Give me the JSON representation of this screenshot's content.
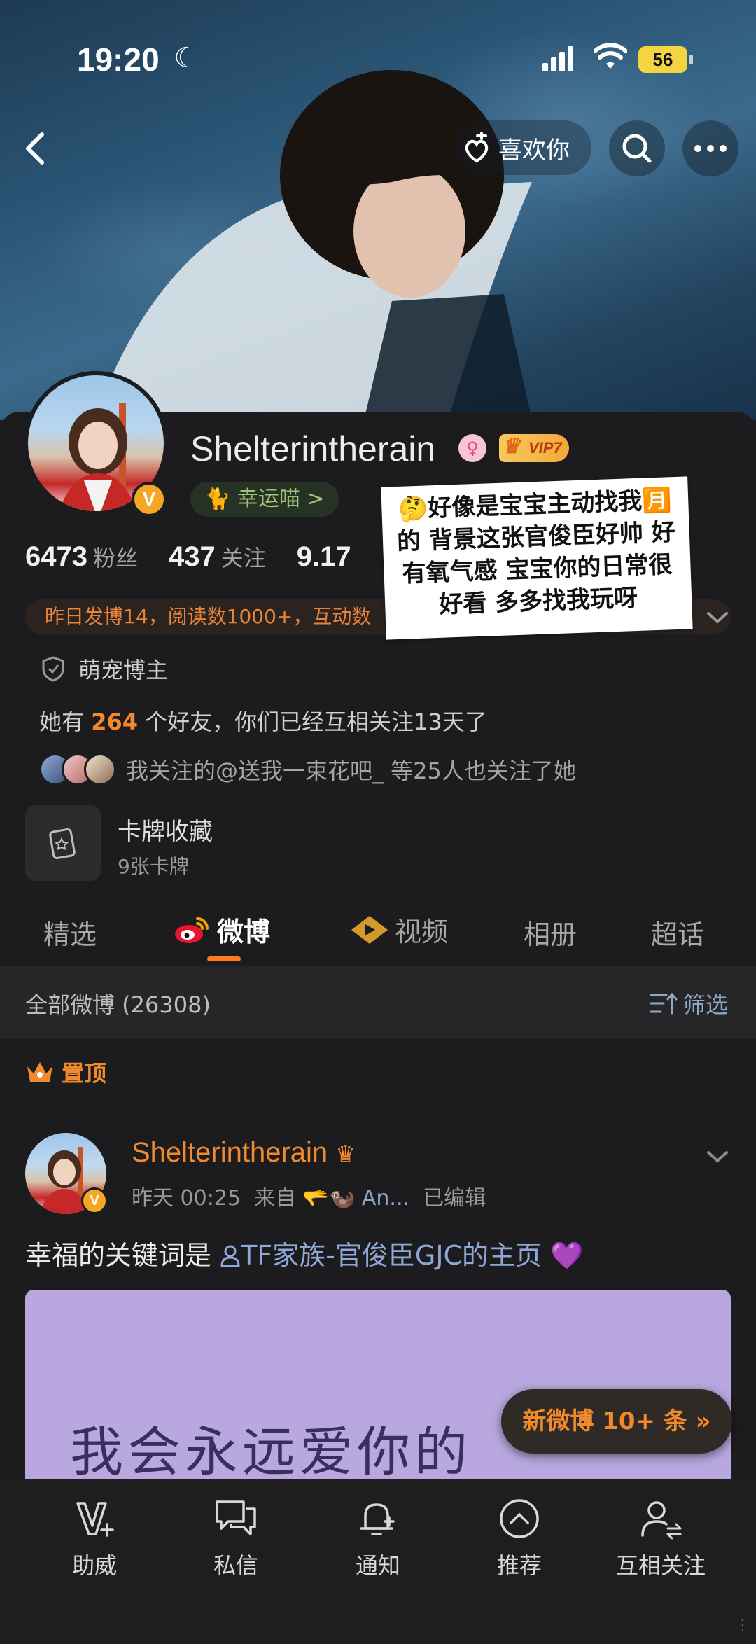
{
  "status_bar": {
    "time": "19:20",
    "battery": "56"
  },
  "header": {
    "like_label": "喜欢你"
  },
  "profile": {
    "username": "Shelterintherain",
    "vip_label": "VIP7",
    "verified_badge": "V",
    "lucky_tag": "幸运喵 >",
    "stats": {
      "fans_count": "6473",
      "fans_label": "粉丝",
      "following_count": "437",
      "following_label": "关注",
      "third_count": "9.17"
    },
    "activity_text": "昨日发博14，阅读数1000+，互动数",
    "category": "萌宠博主",
    "friends_prefix": "她有",
    "friends_count": "264",
    "friends_suffix": "个好友，你们已经互相关注13天了",
    "mutual_text": "我关注的@送我一束花吧_ 等25人也关注了她",
    "card_title": "卡牌收藏",
    "card_subtitle": "9张卡牌"
  },
  "sticker_text": "🤔好像是宝宝主动找我🈷️的 背景这张官俊臣好帅 好有氧气感 宝宝你的日常很好看 多多找我玩呀",
  "tabs": [
    {
      "label": "精选"
    },
    {
      "label": "微博"
    },
    {
      "label": "视频"
    },
    {
      "label": "相册"
    },
    {
      "label": "超话"
    }
  ],
  "feed_header": {
    "title": "全部微博 (26308)",
    "filter_label": "筛选"
  },
  "pinned_label": "置顶",
  "post": {
    "author": "Shelterintherain",
    "time": "昨天 00:25",
    "source_prefix": "来自",
    "source": "🫳🦦 An...",
    "edited": "已编辑",
    "text_prefix": "幸福的关键词是 ",
    "link_text": "TF家族-官俊臣GJC的主页",
    "heart": "💜",
    "image_caption": "我会永远爱你的"
  },
  "new_posts_label": "新微博 10+ 条 »",
  "bottom_nav": [
    {
      "label": "助威"
    },
    {
      "label": "私信"
    },
    {
      "label": "通知"
    },
    {
      "label": "推荐"
    },
    {
      "label": "互相关注"
    }
  ],
  "colors": {
    "accent": "#f08a2c",
    "background": "#1c1c1e",
    "link": "#8fa8d8"
  }
}
